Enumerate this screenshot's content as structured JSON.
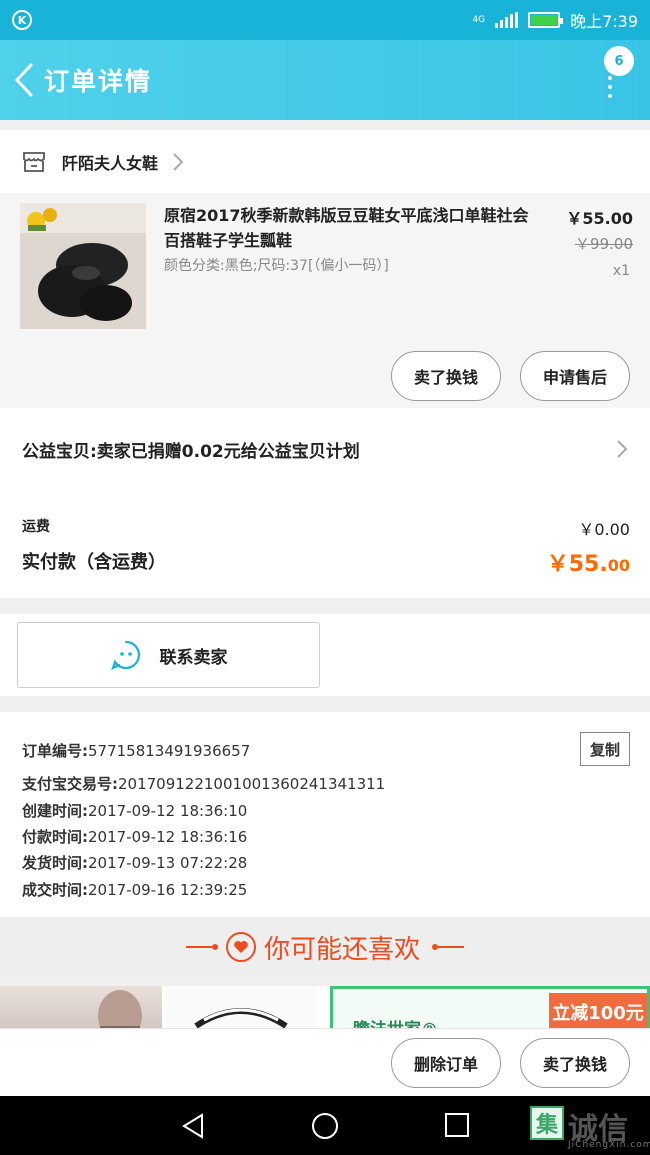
{
  "status_bar": {
    "network": "4G",
    "time": "晚上7:39"
  },
  "header": {
    "title": "订单详情",
    "badge_count": "6"
  },
  "store": {
    "name": "阡陌夫人女鞋"
  },
  "item": {
    "title": "原宿2017秋季新款韩版豆豆鞋女平底浅口单鞋社会百搭鞋子学生瓢鞋",
    "sku": "颜色分类:黑色;尺码:37[（偏小一码）]",
    "price_now": "￥55.00",
    "price_old": "￥99.00",
    "qty": "x1",
    "buttons": {
      "sell_swap": "卖了换钱",
      "after_sale": "申请售后"
    }
  },
  "charity": {
    "text": "公益宝贝:卖家已捐赠0.02元给公益宝贝计划"
  },
  "fees": {
    "shipping_label": "运费",
    "shipping_value": "￥0.00",
    "paid_label": "实付款（含运费）",
    "paid_currency_big": "￥55.",
    "paid_currency_small": "00"
  },
  "contact": {
    "label": "联系卖家"
  },
  "order_info": {
    "copy_label": "复制",
    "lines": [
      {
        "k": "订单编号:",
        "v": "57715813491936657"
      },
      {
        "k": "支付宝交易号:",
        "v": "2017091221001001360241341311"
      },
      {
        "k": "创建时间:",
        "v": "2017-09-12 18:36:10"
      },
      {
        "k": "付款时间:",
        "v": "2017-09-12 18:36:16"
      },
      {
        "k": "发货时间:",
        "v": "2017-09-13 07:22:28"
      },
      {
        "k": "成交时间:",
        "v": "2017-09-16 12:39:25"
      }
    ]
  },
  "recommend": {
    "title": "你可能还喜欢",
    "promo_tag": "立减100元",
    "promo_text": "瞻法世家®"
  },
  "bottom_actions": {
    "delete_order": "删除订单",
    "sell_swap": "卖了换钱"
  },
  "watermark": {
    "box_char": "集",
    "text": "诚信",
    "sub": "JiChengXin.com"
  },
  "colors": {
    "header_bg": "#4fd1ea",
    "status_bg": "#1ab3d8",
    "accent_orange": "#ff6a00",
    "recommend_red": "#ee4b1f"
  }
}
